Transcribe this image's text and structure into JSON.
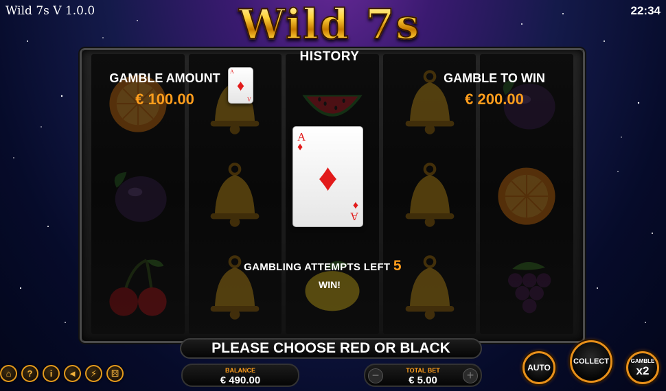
{
  "window": {
    "title": "Wild 7s V 1.0.0",
    "clock": "22:34"
  },
  "logo": {
    "text": "Wild 7s"
  },
  "history": {
    "label": "HISTORY",
    "card": {
      "rank": "A",
      "suit": "♦"
    }
  },
  "gamble": {
    "amount_label": "GAMBLE AMOUNT",
    "amount_value": "€ 100.00",
    "to_win_label": "GAMBLE TO WIN",
    "to_win_value": "€ 200.00",
    "card": {
      "rank": "A",
      "suit": "♦",
      "color": "#e21b1b"
    },
    "attempts_label": "GAMBLING ATTEMPTS LEFT",
    "attempts_value": "5",
    "result": "WIN!"
  },
  "reels": [
    [
      "orange",
      "plum",
      "cherry"
    ],
    [
      "bell",
      "bell",
      "bell"
    ],
    [
      "watermelon",
      "watermelon",
      "lemon"
    ],
    [
      "bell",
      "bell",
      "bell"
    ],
    [
      "plum",
      "orange",
      "grapes"
    ]
  ],
  "message": "PLEASE CHOOSE RED OR BLACK",
  "bottom_bar": {
    "icons": [
      "home-icon",
      "help-icon",
      "info-icon",
      "sound-icon",
      "turbo-icon",
      "dice-icon"
    ],
    "balance_label": "BALANCE",
    "balance_value": "€ 490.00",
    "total_bet_label": "TOTAL BET",
    "total_bet_value": "€ 5.00",
    "minus": "−",
    "plus": "+"
  },
  "buttons": {
    "auto": "AUTO",
    "collect": "COLLECT",
    "gamble_label": "GAMBLE",
    "gamble_multiplier": "x2"
  },
  "colors": {
    "accent": "#ff9d1c",
    "card_red": "#e21b1b",
    "button_ring": "#e8901a"
  }
}
